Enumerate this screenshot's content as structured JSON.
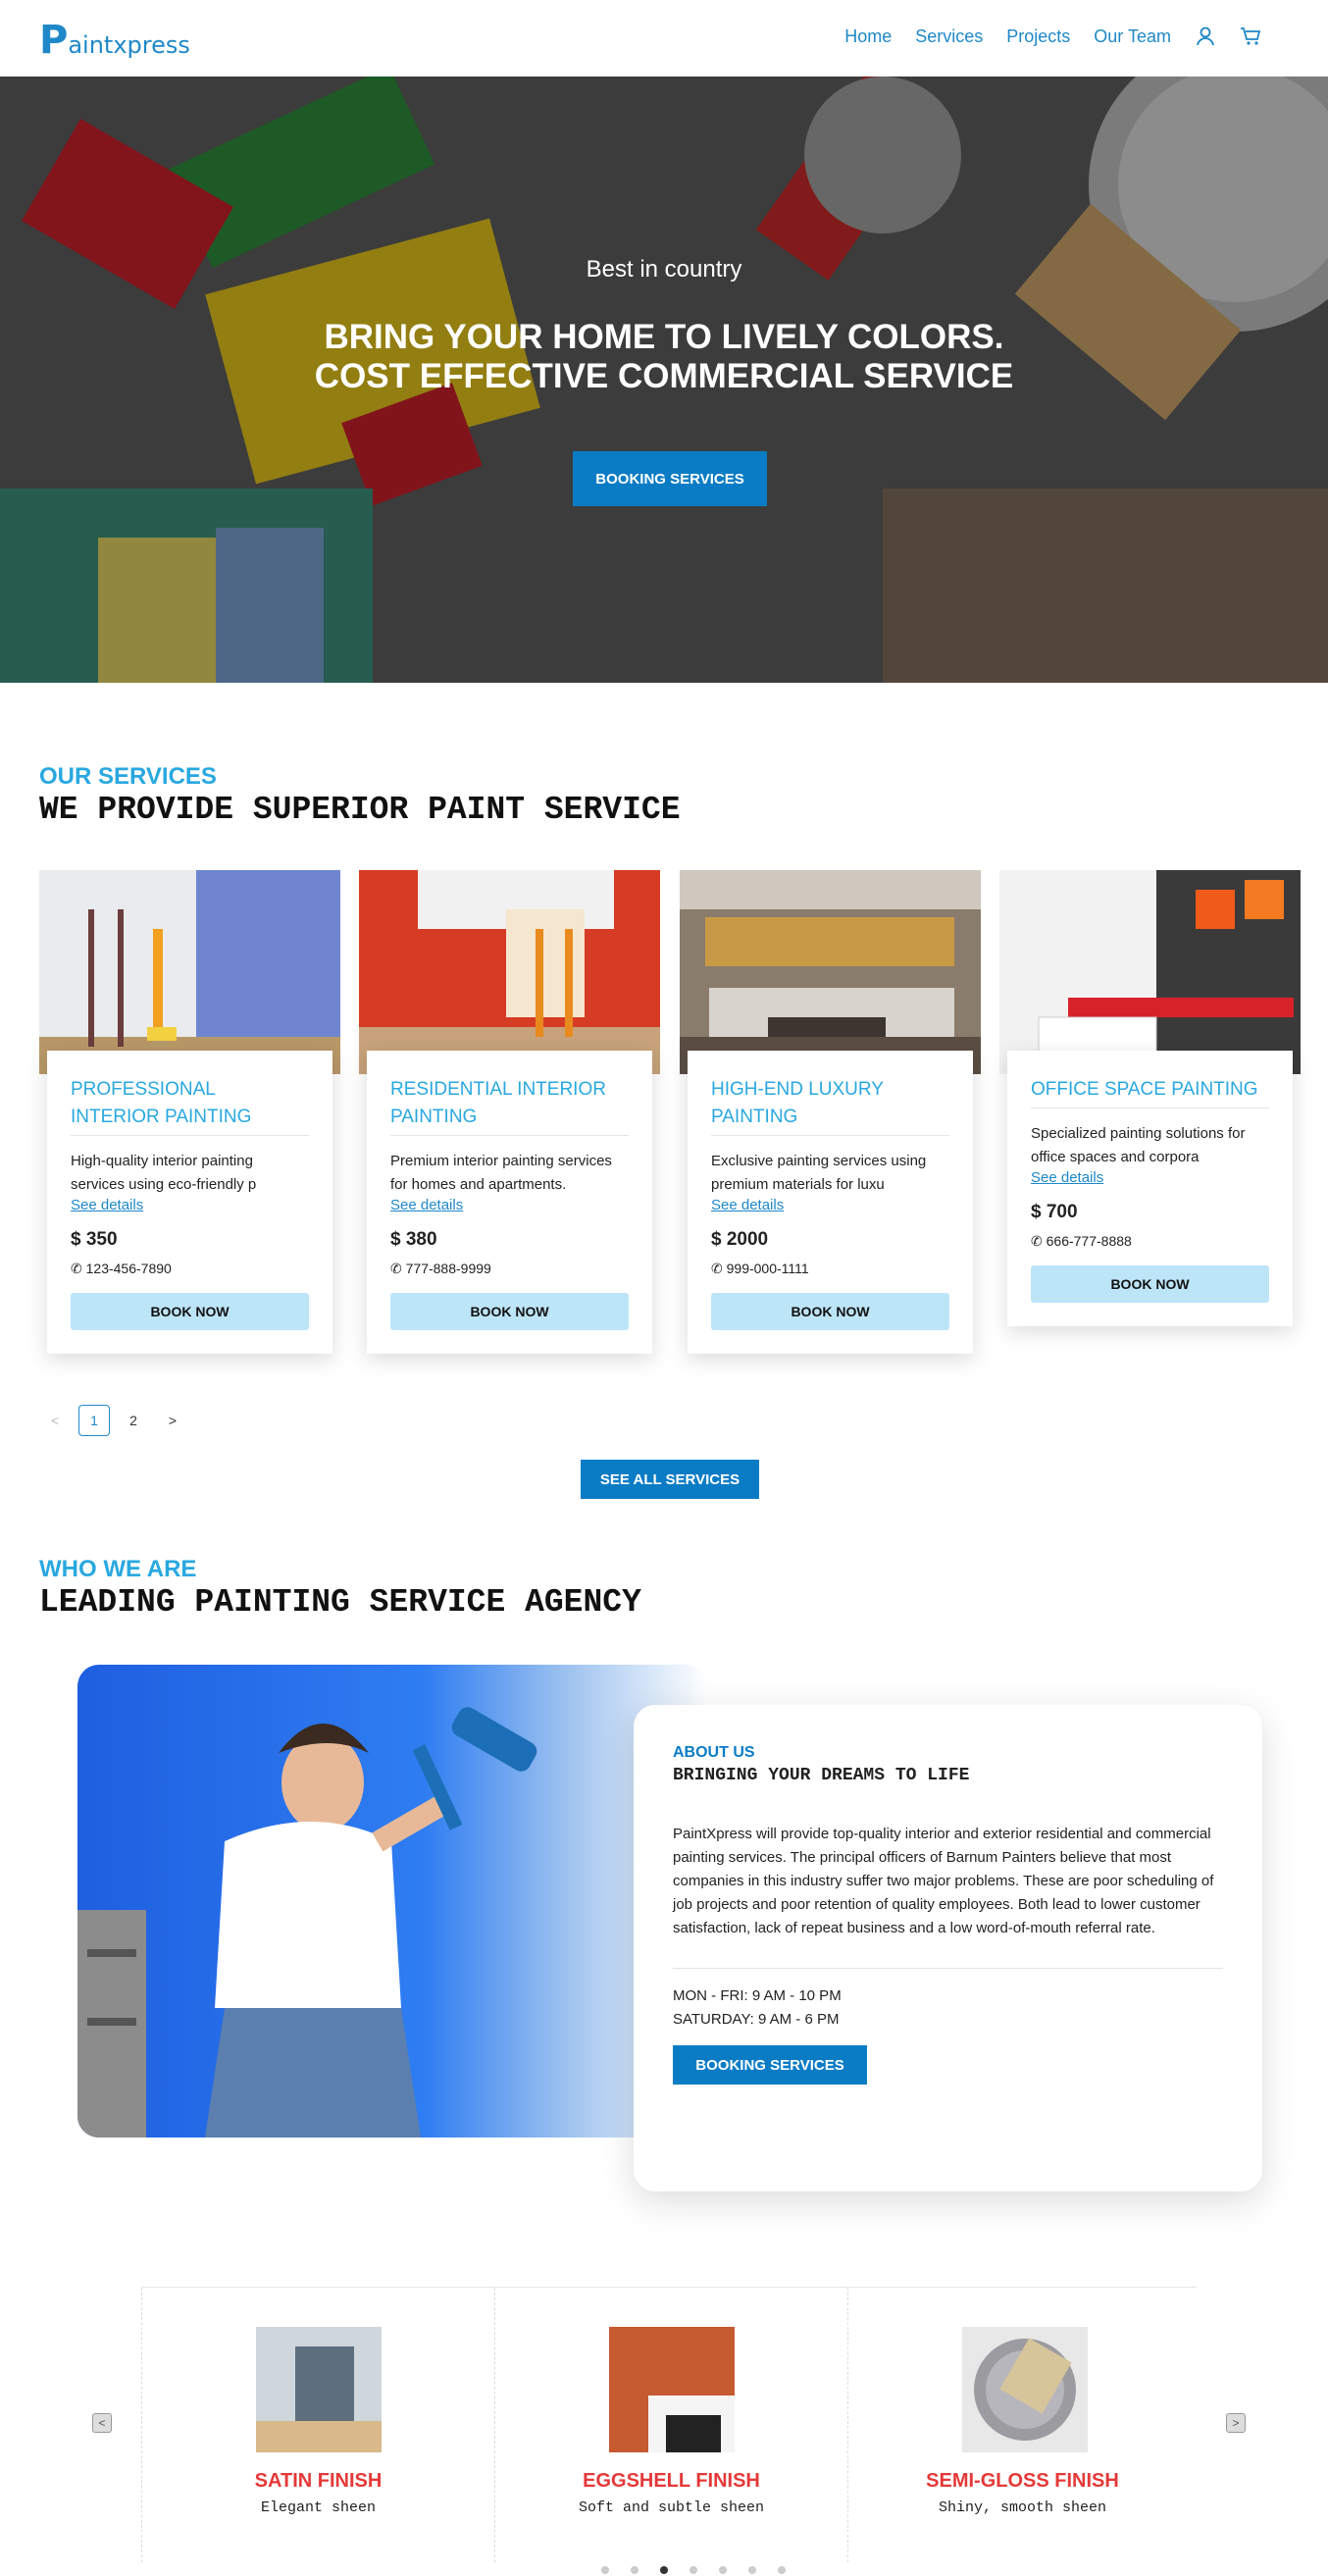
{
  "nav": {
    "logo_initial": "P",
    "logo_rest": "aintxpress",
    "links": [
      "Home",
      "Services",
      "Projects",
      "Our Team"
    ],
    "icons": [
      "user-icon",
      "cart-icon"
    ]
  },
  "hero": {
    "subtitle": "Best in country",
    "title_line1": "BRING YOUR HOME TO LIVELY COLORS.",
    "title_line2": "COST EFFECTIVE COMMERCIAL SERVICE",
    "button": "BOOKING SERVICES"
  },
  "services": {
    "kicker": "OUR SERVICES",
    "heading": "WE PROVIDE SUPERIOR PAINT SERVICE",
    "cards": [
      {
        "title": "PROFESSIONAL INTERIOR PAINTING",
        "desc": "High-quality interior painting services using eco-friendly p",
        "more": "See details",
        "price": "$ 350",
        "phone": "123-456-7890",
        "book": "BOOK NOW"
      },
      {
        "title": "RESIDENTIAL INTERIOR PAINTING",
        "desc": "Premium interior painting services for homes and apartments.",
        "more": "See details",
        "price": "$ 380",
        "phone": "777-888-9999",
        "book": "BOOK NOW"
      },
      {
        "title": "HIGH-END LUXURY PAINTING",
        "desc": "Exclusive painting services using premium materials for luxu",
        "more": "See details",
        "price": "$ 2000",
        "phone": "999-000-1111",
        "book": "BOOK NOW"
      },
      {
        "title": "OFFICE SPACE PAINTING",
        "desc": "Specialized painting solutions for office spaces and corpora",
        "more": "See details",
        "price": "$ 700",
        "phone": "666-777-8888",
        "book": "BOOK NOW"
      }
    ],
    "pager": {
      "prev": "<",
      "pages": [
        "1",
        "2"
      ],
      "next": ">"
    },
    "see_all": "SEE ALL SERVICES"
  },
  "about": {
    "kicker": "WHO WE ARE",
    "heading": "LEADING PAINTING SERVICE AGENCY",
    "card_kicker": "ABOUT US",
    "card_title": "BRINGING YOUR DREAMS TO LIFE",
    "body": "PaintXpress will provide top-quality interior and exterior residential and commercial painting services. The principal officers of Barnum Painters believe that most companies in this industry suffer two major problems. These are poor scheduling of job projects and poor retention of quality employees. Both lead to lower customer satisfaction, lack of repeat business and a low word-of-mouth referral rate.",
    "hours_weekday": "MON - FRI: 9 AM - 10 PM",
    "hours_saturday": "SATURDAY: 9 AM - 6 PM",
    "button": "BOOKING SERVICES"
  },
  "finishes": [
    {
      "name": "SATIN FINISH",
      "sub": "Elegant sheen"
    },
    {
      "name": "EGGSHELL FINISH",
      "sub": "Soft and subtle sheen"
    },
    {
      "name": "SEMI-GLOSS FINISH",
      "sub": "Shiny, smooth sheen"
    }
  ],
  "carousel": {
    "prev": "<",
    "next": ">"
  }
}
